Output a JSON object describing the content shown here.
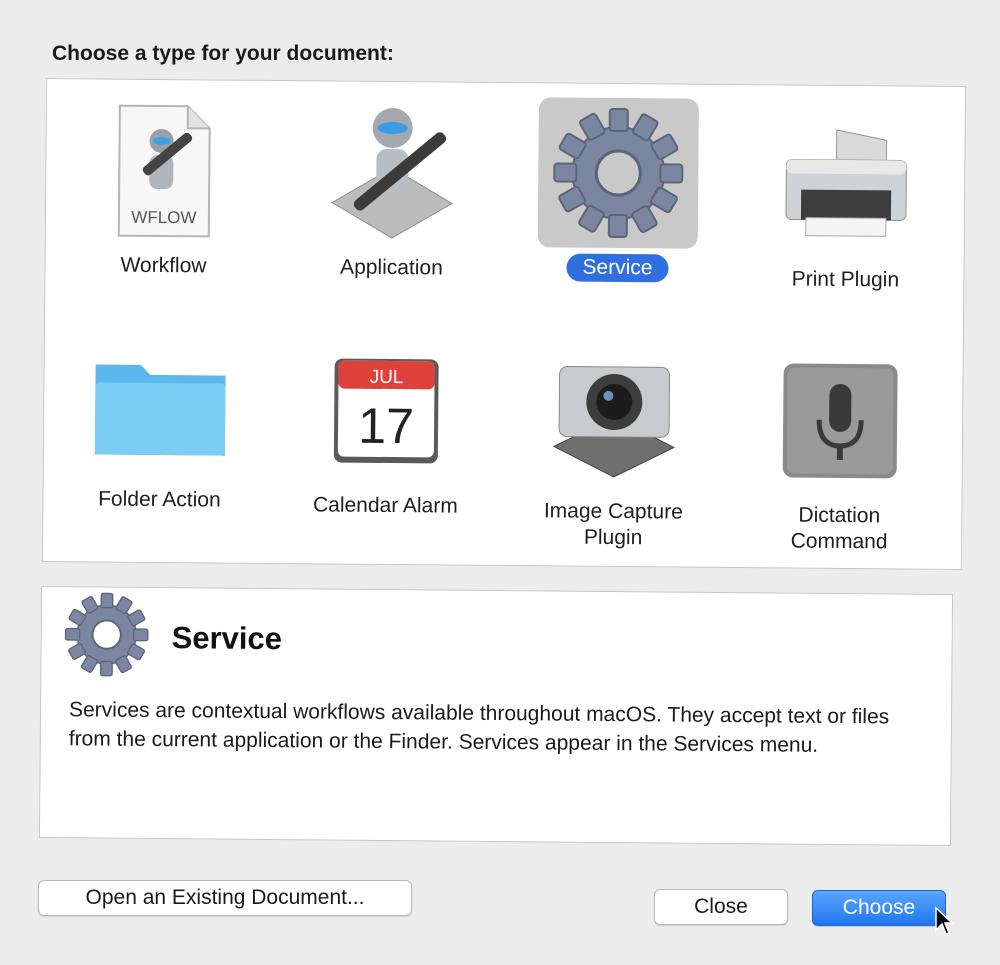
{
  "dialog": {
    "heading": "Choose a type for your document:",
    "types": [
      {
        "label": "Workflow",
        "icon": "workflow-file-icon",
        "file_tag": "WFLOW"
      },
      {
        "label": "Application",
        "icon": "automator-robot-icon"
      },
      {
        "label": "Service",
        "icon": "gear-icon",
        "selected": true
      },
      {
        "label": "Print Plugin",
        "icon": "printer-icon"
      },
      {
        "label": "Folder Action",
        "icon": "folder-icon"
      },
      {
        "label": "Calendar Alarm",
        "icon": "calendar-icon",
        "month": "JUL",
        "day": "17"
      },
      {
        "label": "Image Capture\nPlugin",
        "icon": "camera-icon"
      },
      {
        "label": "Dictation\nCommand",
        "icon": "microphone-icon"
      }
    ],
    "info": {
      "title": "Service",
      "description": "Services are contextual workflows available throughout macOS. They accept text or files from the current application or the Finder. Services appear in the Services menu."
    },
    "buttons": {
      "open_existing": "Open an Existing Document...",
      "close": "Close",
      "choose": "Choose"
    },
    "colors": {
      "accent": "#2f6fe0",
      "selection_bg": "#c9c9c9"
    }
  }
}
